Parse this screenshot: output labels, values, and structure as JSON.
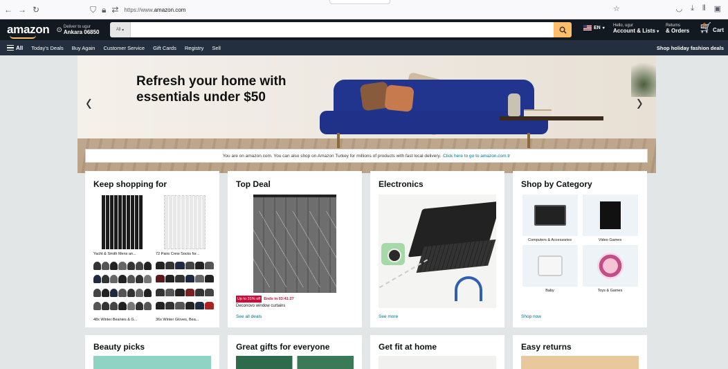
{
  "browser": {
    "url_prefix": "https://www.",
    "url_domain": "amazon.com"
  },
  "header": {
    "logo": "amazon",
    "deliver_small": "Deliver to ugur",
    "deliver_big": "Ankara 06850",
    "search_category": "All",
    "search_placeholder": "",
    "lang": "EN",
    "account_small": "Hello, ugur",
    "account_big": "Account & Lists",
    "returns_small": "Returns",
    "returns_big": "& Orders",
    "cart_count": "0",
    "cart_label": "Cart"
  },
  "subnav": {
    "all": "All",
    "items": [
      "Today's Deals",
      "Buy Again",
      "Customer Service",
      "Gift Cards",
      "Registry",
      "Sell"
    ],
    "right": "Shop holiday fashion deals"
  },
  "hero": {
    "title": "Refresh your home with essentials under $50",
    "prev": "‹",
    "next": "›"
  },
  "notice": {
    "text": "You are on amazon.com. You can also shop on Amazon Turkey for millions of products with fast local delivery.",
    "link": "Click here to go to amazon.com.tr"
  },
  "cards": {
    "keep": {
      "title": "Keep shopping for",
      "items": [
        "Yacht & Smith Mens an...",
        "72 Pairs Crew Socks for...",
        "48x Winter Beanies & G...",
        "36x Winter Gloves, Bea..."
      ]
    },
    "deal": {
      "title": "Top Deal",
      "pct": "Up to 31% off",
      "ends": "Ends in 03:41:27",
      "name": "Deconovo window curtains",
      "link": "See all deals"
    },
    "electronics": {
      "title": "Electronics",
      "link": "See more"
    },
    "category": {
      "title": "Shop by Category",
      "items": [
        "Computers & Accessories",
        "Video Games",
        "Baby",
        "Toys & Games"
      ],
      "link": "Shop now"
    },
    "row2": [
      "Beauty picks",
      "Great gifts for everyone",
      "Get fit at home",
      "Easy returns"
    ]
  },
  "colors": {
    "header_bg": "#131921",
    "subnav_bg": "#232f3e",
    "search_button": "#febd69",
    "link": "#007185",
    "deal_red": "#cc0c39"
  }
}
